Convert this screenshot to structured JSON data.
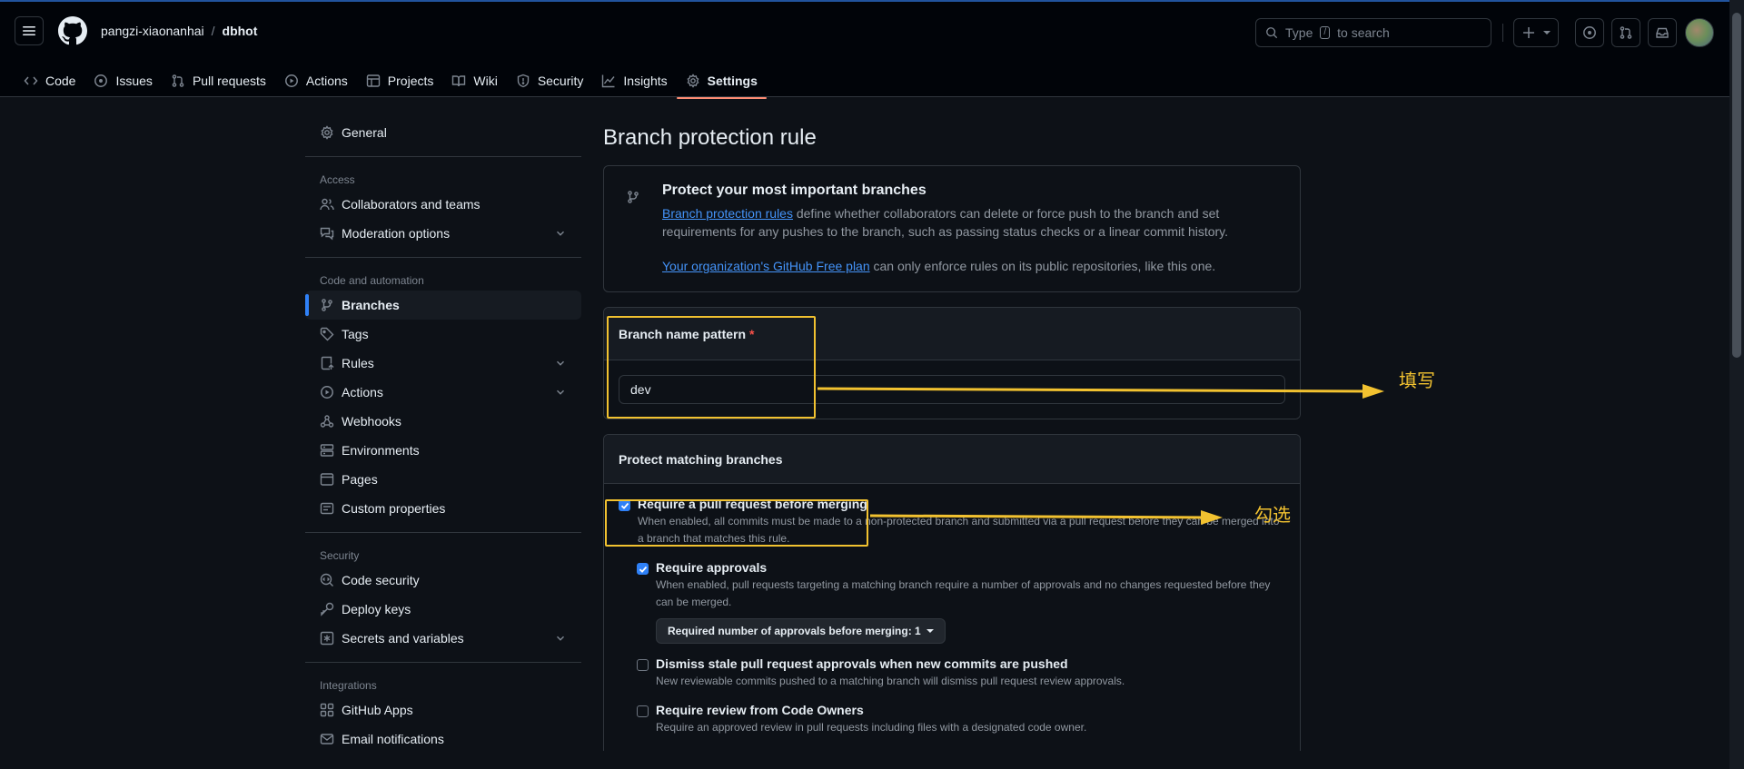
{
  "header": {
    "owner": "pangzi-xiaonanhai",
    "separator": "/",
    "repo": "dbhot",
    "search_before": "Type",
    "search_key": "/",
    "search_after": "to search"
  },
  "tabs": [
    {
      "label": "Code",
      "icon": "code-icon"
    },
    {
      "label": "Issues",
      "icon": "issue-icon"
    },
    {
      "label": "Pull requests",
      "icon": "pull-request-icon"
    },
    {
      "label": "Actions",
      "icon": "play-icon"
    },
    {
      "label": "Projects",
      "icon": "table-icon"
    },
    {
      "label": "Wiki",
      "icon": "book-icon"
    },
    {
      "label": "Security",
      "icon": "shield-icon"
    },
    {
      "label": "Insights",
      "icon": "graph-icon"
    },
    {
      "label": "Settings",
      "icon": "gear-icon",
      "active": true
    }
  ],
  "sidebar": {
    "general": "General",
    "access_heading": "Access",
    "access": [
      {
        "label": "Collaborators and teams"
      },
      {
        "label": "Moderation options"
      }
    ],
    "code_heading": "Code and automation",
    "code": [
      {
        "label": "Branches"
      },
      {
        "label": "Tags"
      },
      {
        "label": "Rules"
      },
      {
        "label": "Actions"
      },
      {
        "label": "Webhooks"
      },
      {
        "label": "Environments"
      },
      {
        "label": "Pages"
      },
      {
        "label": "Custom properties"
      }
    ],
    "security_heading": "Security",
    "security": [
      {
        "label": "Code security"
      },
      {
        "label": "Deploy keys"
      },
      {
        "label": "Secrets and variables"
      }
    ],
    "integrations_heading": "Integrations",
    "integrations": [
      {
        "label": "GitHub Apps"
      },
      {
        "label": "Email notifications"
      }
    ]
  },
  "main": {
    "title": "Branch protection rule",
    "info": {
      "title": "Protect your most important branches",
      "link1": "Branch protection rules",
      "text1": " define whether collaborators can delete or force push to the branch and set requirements for any pushes to the branch, such as passing status checks or a linear commit history.",
      "link2": "Your organization's GitHub Free plan",
      "text2": " can only enforce rules on its public repositories, like this one."
    },
    "pattern": {
      "label": "Branch name pattern",
      "required_mark": "*",
      "value": "dev"
    },
    "protect": {
      "heading": "Protect matching branches",
      "options": [
        {
          "label": "Require a pull request before merging",
          "desc": "When enabled, all commits must be made to a non-protected branch and submitted via a pull request before they can be merged into a branch that matches this rule.",
          "checked": true
        },
        {
          "label": "Require approvals",
          "desc": "When enabled, pull requests targeting a matching branch require a number of approvals and no changes requested before they can be merged.",
          "checked": true,
          "select": "Required number of approvals before merging: 1"
        },
        {
          "label": "Dismiss stale pull request approvals when new commits are pushed",
          "desc": "New reviewable commits pushed to a matching branch will dismiss pull request review approvals.",
          "checked": false
        },
        {
          "label": "Require review from Code Owners",
          "desc": "Require an approved review in pull requests including files with a designated code owner.",
          "checked": false
        }
      ]
    }
  },
  "annotations": {
    "fill_label": "填写",
    "check_label": "勾选",
    "color": "#f2c230"
  }
}
